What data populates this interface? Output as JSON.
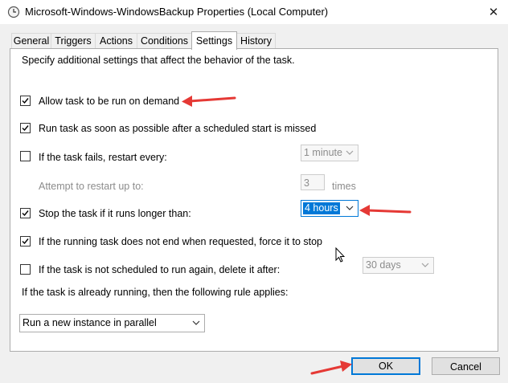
{
  "window": {
    "title": "Microsoft-Windows-WindowsBackup Properties (Local Computer)",
    "close_glyph": "✕"
  },
  "tabs": [
    "General",
    "Triggers",
    "Actions",
    "Conditions",
    "Settings",
    "History"
  ],
  "active_tab": "Settings",
  "settings": {
    "description": "Specify additional settings that affect the behavior of the task.",
    "allow_on_demand": {
      "label": "Allow task to be run on demand",
      "checked": true
    },
    "run_asap": {
      "label": "Run task as soon as possible after a scheduled start is missed",
      "checked": true
    },
    "restart_on_fail": {
      "label": "If the task fails, restart every:",
      "checked": false,
      "value": "1 minute"
    },
    "restart_attempts": {
      "label": "Attempt to restart up to:",
      "value": "3",
      "unit": "times"
    },
    "stop_if_longer": {
      "label": "Stop the task if it runs longer than:",
      "checked": true,
      "value": "4 hours"
    },
    "force_stop": {
      "label": "If the running task does not end when requested, force it to stop",
      "checked": true
    },
    "delete_if_not_scheduled": {
      "label": "If the task is not scheduled to run again, delete it after:",
      "checked": false,
      "value": "30 days"
    },
    "rule_label": "If the task is already running, then the following rule applies:",
    "rule_value": "Run a new instance in parallel"
  },
  "buttons": {
    "ok": "OK",
    "cancel": "Cancel"
  },
  "colors": {
    "annotation_arrow": "#e53935",
    "focus_blue": "#0078d7"
  }
}
